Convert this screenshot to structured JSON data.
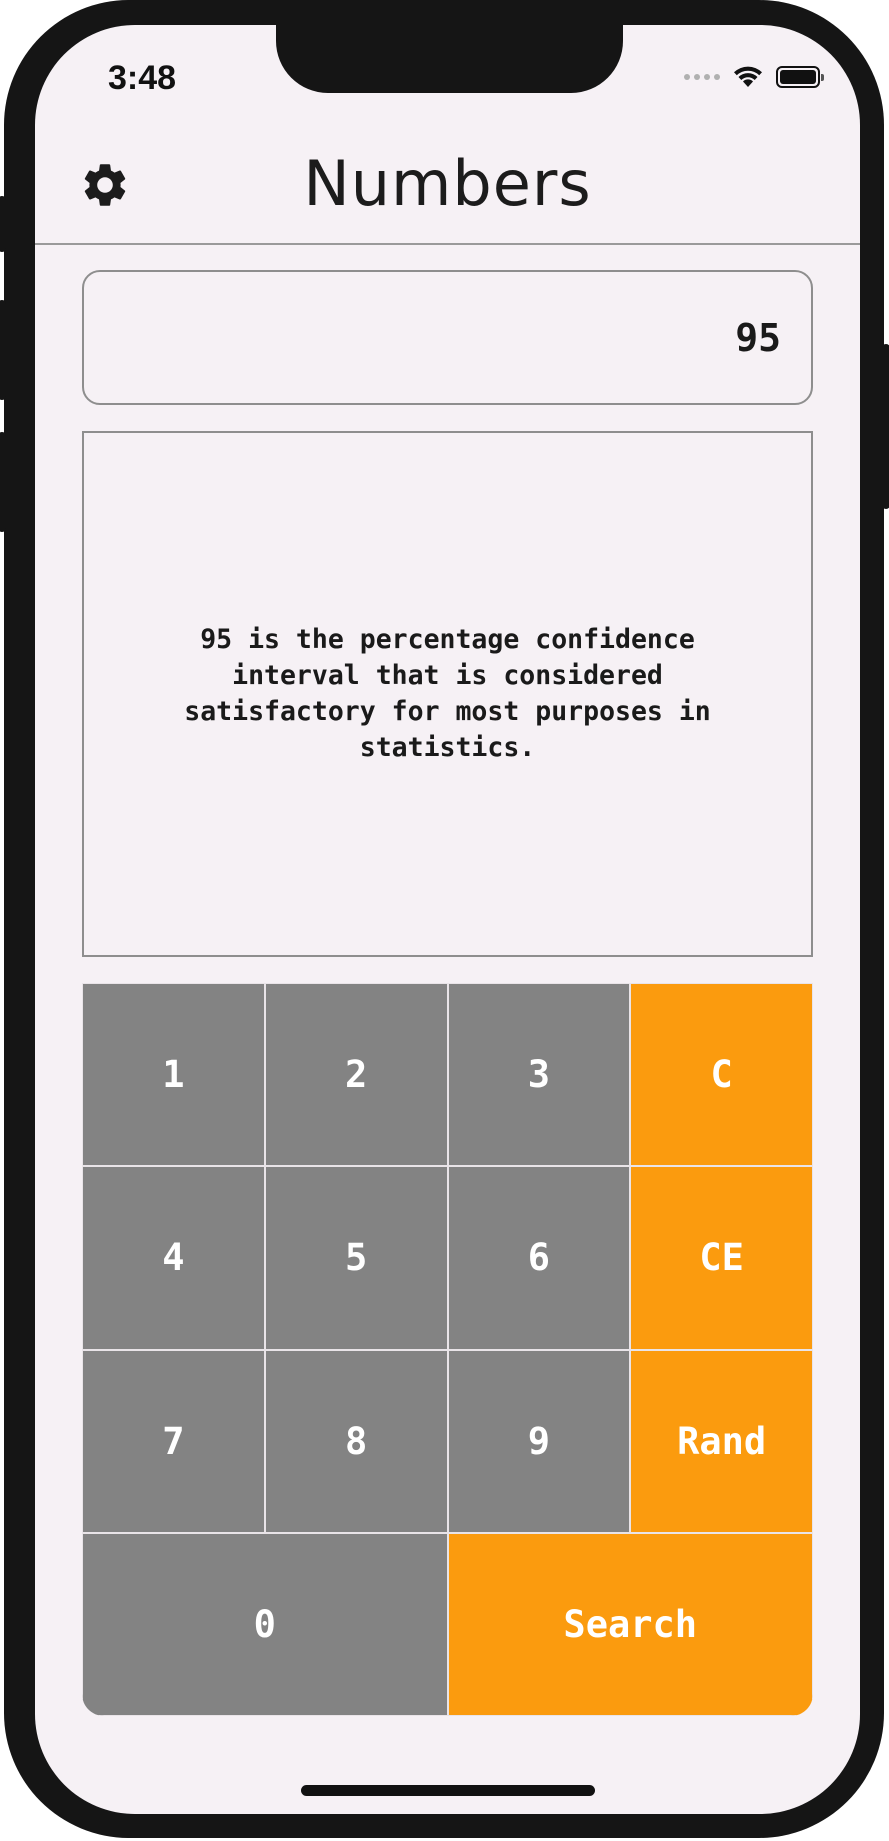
{
  "status_bar": {
    "time": "3:48"
  },
  "app_bar": {
    "title": "Numbers",
    "settings_icon": "gear-icon"
  },
  "number_input": {
    "value": "95"
  },
  "fact": {
    "text": "95 is the percentage confidence interval that is considered satisfactory for most purposes in statistics."
  },
  "keypad": {
    "keys": [
      {
        "label": "1",
        "kind": "num"
      },
      {
        "label": "2",
        "kind": "num"
      },
      {
        "label": "3",
        "kind": "num"
      },
      {
        "label": "C",
        "kind": "op"
      },
      {
        "label": "4",
        "kind": "num"
      },
      {
        "label": "5",
        "kind": "num"
      },
      {
        "label": "6",
        "kind": "num"
      },
      {
        "label": "CE",
        "kind": "op"
      },
      {
        "label": "7",
        "kind": "num"
      },
      {
        "label": "8",
        "kind": "num"
      },
      {
        "label": "9",
        "kind": "num"
      },
      {
        "label": "Rand",
        "kind": "op"
      },
      {
        "label": "0",
        "kind": "num"
      },
      {
        "label": "Search",
        "kind": "op"
      }
    ]
  },
  "colors": {
    "background": "#f6f1f5",
    "number_key": "#838383",
    "action_key": "#fb9b0e",
    "border": "#8e8e8e"
  }
}
